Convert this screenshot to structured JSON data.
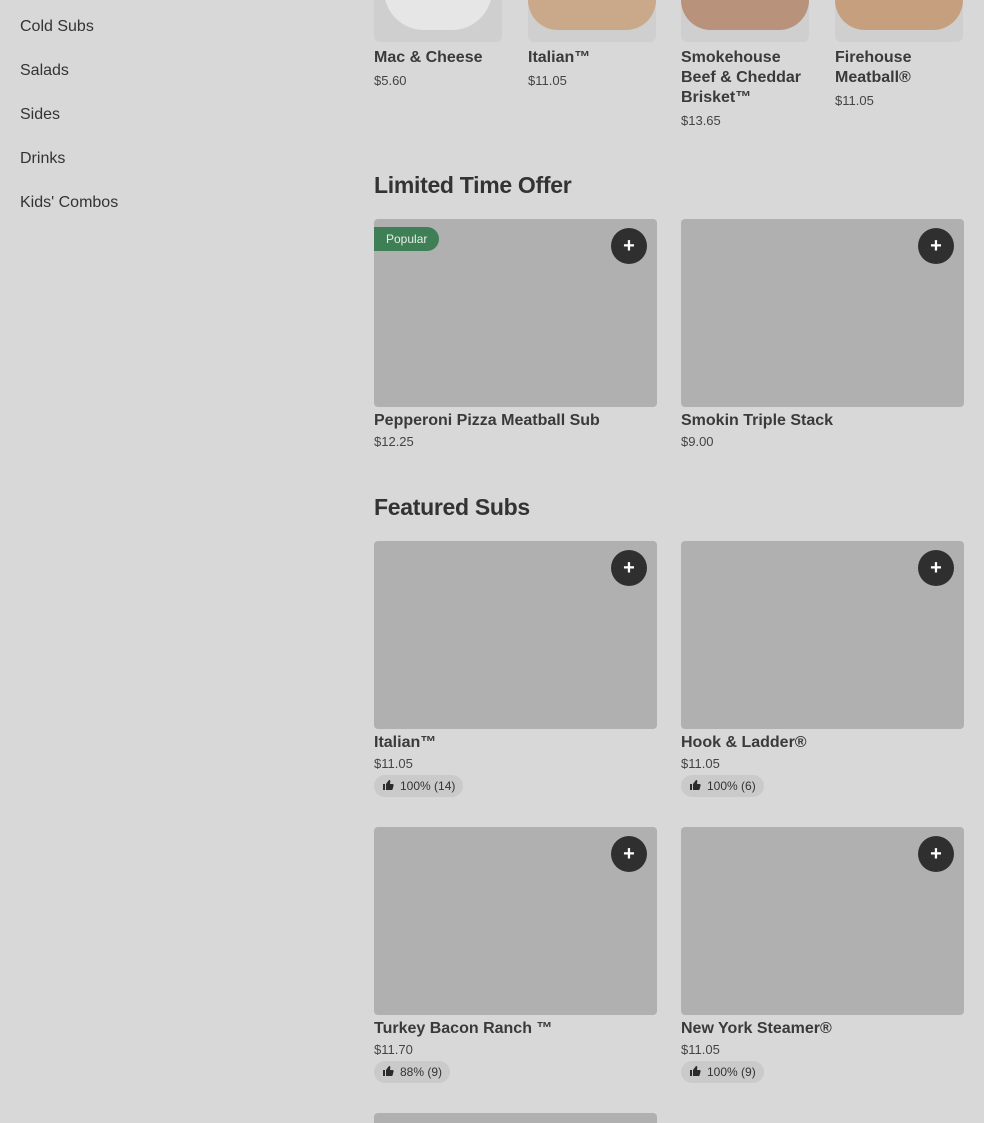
{
  "sidebar": {
    "items": [
      {
        "label": "Cold Subs"
      },
      {
        "label": "Salads"
      },
      {
        "label": "Sides"
      },
      {
        "label": "Drinks"
      },
      {
        "label": "Kids' Combos"
      }
    ]
  },
  "top_row": [
    {
      "name": "Mac & Cheese",
      "price": "$5.60"
    },
    {
      "name": "Italian™",
      "price": "$11.05"
    },
    {
      "name": "Smokehouse Beef & Cheddar Brisket™",
      "price": "$13.65"
    },
    {
      "name": "Firehouse Meatball®",
      "price": "$11.05"
    }
  ],
  "limited": {
    "title": "Limited Time Offer",
    "items": [
      {
        "name": "Pepperoni Pizza Meatball Sub",
        "price": "$12.25",
        "badge": "Popular"
      },
      {
        "name": "Smokin Triple Stack",
        "price": "$9.00"
      }
    ]
  },
  "featured": {
    "title": "Featured Subs",
    "items": [
      {
        "name": "Italian™",
        "price": "$11.05",
        "rating": "100% (14)"
      },
      {
        "name": "Hook & Ladder®",
        "price": "$11.05",
        "rating": "100% (6)"
      },
      {
        "name": "Turkey Bacon Ranch ™",
        "price": "$11.70",
        "rating": "88% (9)"
      },
      {
        "name": "New York Steamer®",
        "price": "$11.05",
        "rating": "100% (9)"
      }
    ]
  },
  "icons": {
    "add": "plus-icon",
    "thumb": "thumbs-up-icon"
  },
  "colors": {
    "badge": "#3f7f56",
    "button": "#2f2f2f",
    "overlay": "#d8d8d8"
  },
  "add_symbol": "+"
}
